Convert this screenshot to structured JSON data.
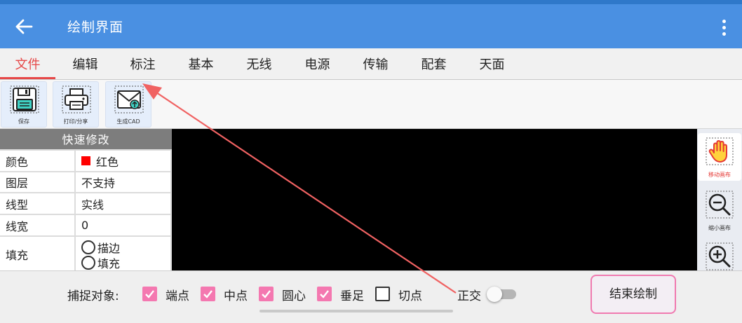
{
  "app_bar": {
    "title": "绘制界面",
    "back_icon": "arrow-left-icon",
    "more_icon": "more-vert-icon",
    "background": "#4a90e2"
  },
  "tabs": [
    {
      "label": "文件",
      "active": true
    },
    {
      "label": "编辑",
      "active": false
    },
    {
      "label": "标注",
      "active": false
    },
    {
      "label": "基本",
      "active": false
    },
    {
      "label": "无线",
      "active": false
    },
    {
      "label": "电源",
      "active": false
    },
    {
      "label": "传输",
      "active": false
    },
    {
      "label": "配套",
      "active": false
    },
    {
      "label": "天面",
      "active": false
    }
  ],
  "toolbar": {
    "items": [
      {
        "label": "保存",
        "icon": "floppy-disk-icon"
      },
      {
        "label": "打印/分享",
        "icon": "printer-icon"
      },
      {
        "label": "生成CAD",
        "icon": "envelope-upload-icon"
      }
    ]
  },
  "properties": {
    "title": "快速修改",
    "rows": [
      {
        "key": "颜色",
        "value": "红色",
        "swatch": "#ff0000"
      },
      {
        "key": "图层",
        "value": "不支持"
      },
      {
        "key": "线型",
        "value": "实线"
      },
      {
        "key": "线宽",
        "value": "0"
      },
      {
        "key": "填充",
        "options": [
          "描边",
          "填充"
        ]
      }
    ]
  },
  "side_tools": [
    {
      "label": "移动画布",
      "icon": "hand-icon",
      "label_color": "#e53935"
    },
    {
      "label": "缩小画布",
      "icon": "zoom-out-icon",
      "label_color": "#333333"
    },
    {
      "label": "",
      "icon": "zoom-in-icon",
      "label_color": "#333333"
    }
  ],
  "snap": {
    "label": "捕捉对象:",
    "options": [
      {
        "label": "端点",
        "checked": true
      },
      {
        "label": "中点",
        "checked": true
      },
      {
        "label": "圆心",
        "checked": true
      },
      {
        "label": "垂足",
        "checked": true
      },
      {
        "label": "切点",
        "checked": false
      }
    ],
    "ortho_label": "正交",
    "ortho_on": false
  },
  "end_button": {
    "label": "结束绘制"
  },
  "colors": {
    "accent": "#e64848",
    "check_on": "#f478b0",
    "annotation_arrow": "#f06262"
  }
}
